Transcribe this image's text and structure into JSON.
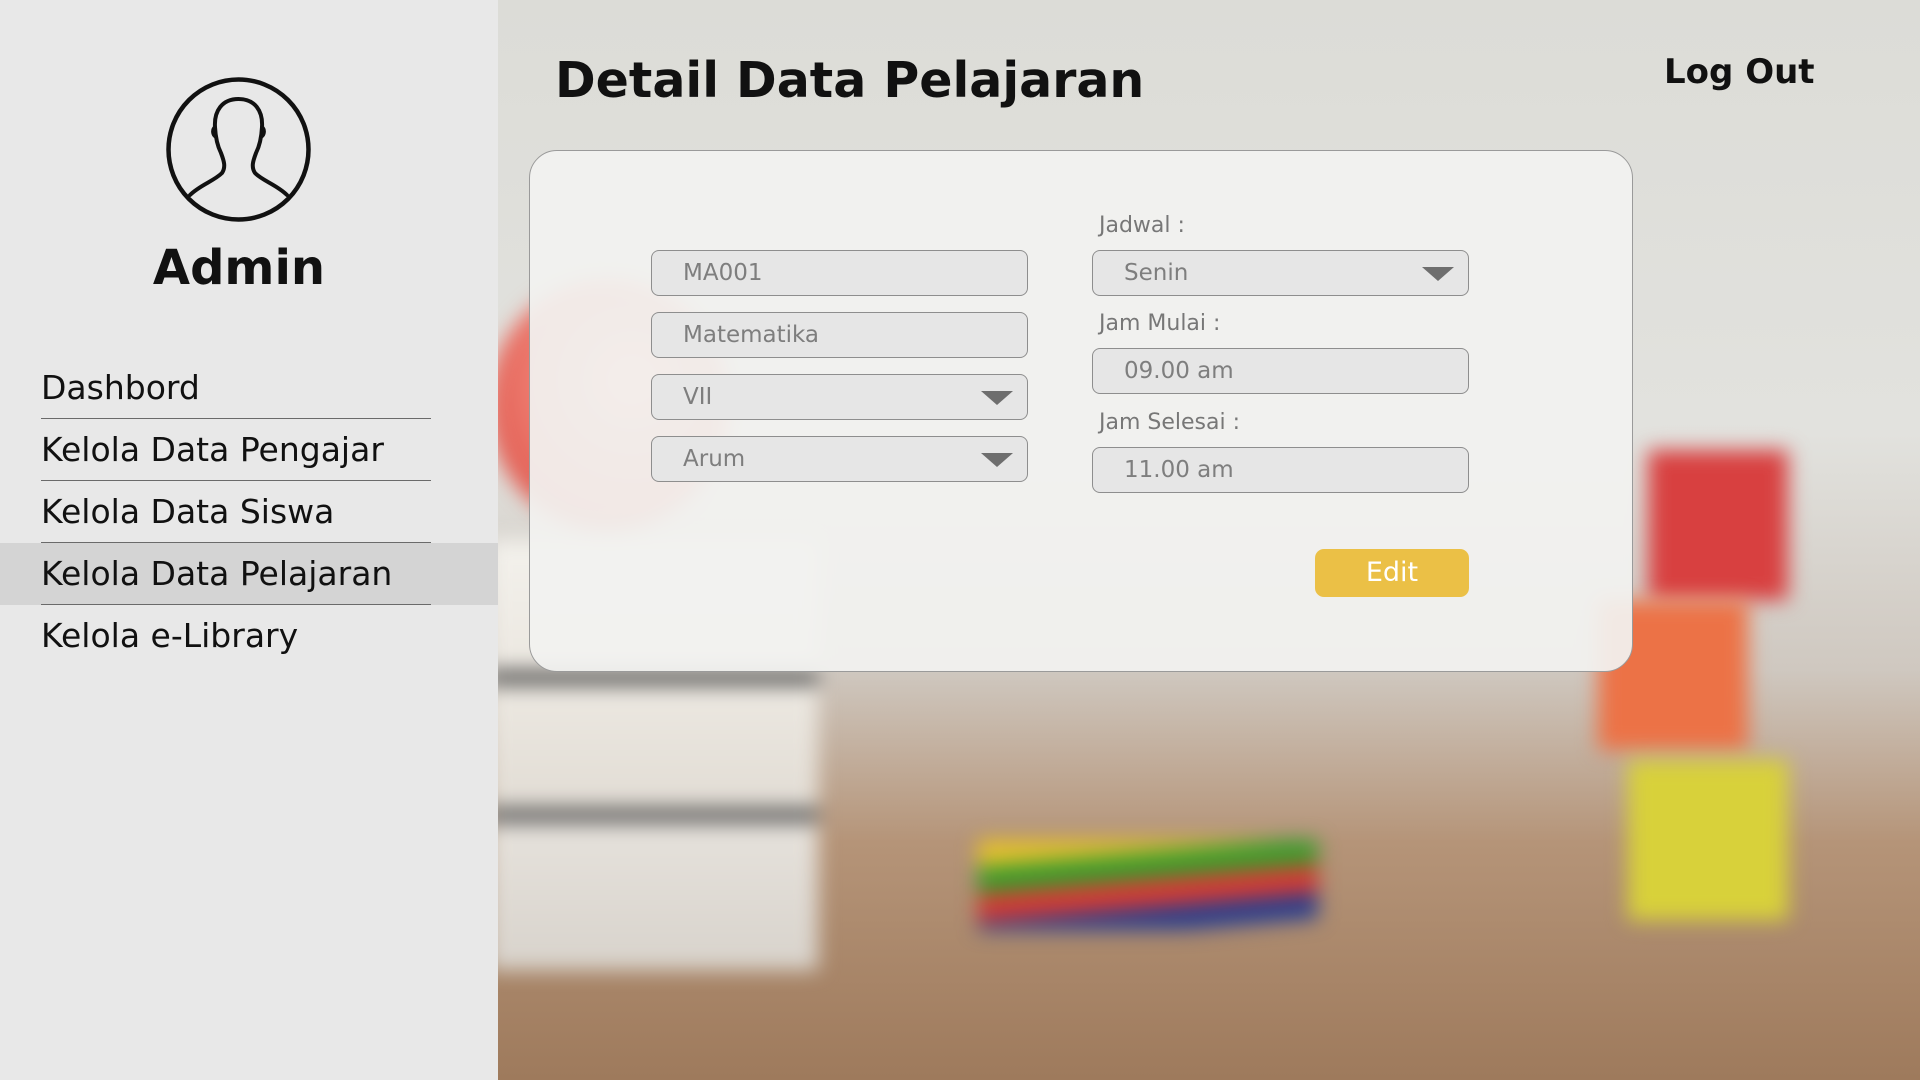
{
  "sidebar": {
    "user_name": "Admin",
    "nav_items": [
      {
        "label": "Dashbord"
      },
      {
        "label": "Kelola Data Pengajar"
      },
      {
        "label": "Kelola Data Siswa"
      },
      {
        "label": "Kelola Data Pelajaran",
        "active": true
      },
      {
        "label": "Kelola e-Library"
      }
    ]
  },
  "header": {
    "title": "Detail Data Pelajaran",
    "logout_label": "Log Out"
  },
  "form": {
    "kode": "MA001",
    "nama": "Matematika",
    "kelas": "VII",
    "pengajar": "Arum",
    "jadwal_label": "Jadwal :",
    "jadwal": "Senin",
    "jam_mulai_label": "Jam Mulai :",
    "jam_mulai": "09.00 am",
    "jam_selesai_label": "Jam Selesai :",
    "jam_selesai": "11.00 am",
    "edit_label": "Edit"
  },
  "colors": {
    "accent": "#ebc046",
    "sidebar_bg": "#e8e8e8",
    "sidebar_active": "#d4d4d4"
  }
}
